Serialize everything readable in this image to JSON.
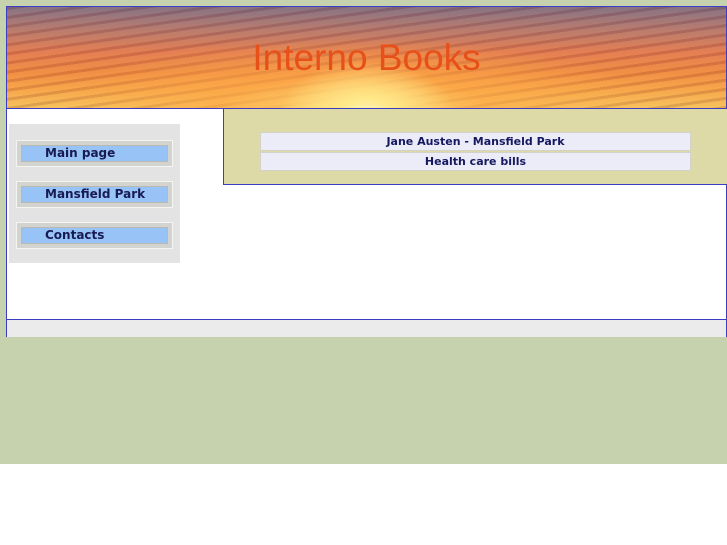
{
  "header": {
    "site_title": "Interno Books"
  },
  "sidebar": {
    "items": [
      {
        "label": "Main page"
      },
      {
        "label": "Mansfield Park"
      },
      {
        "label": "Contacts"
      }
    ]
  },
  "main": {
    "links": [
      {
        "label": "Jane Austen - Mansfield Park"
      },
      {
        "label": "Health care bills"
      }
    ]
  },
  "colors": {
    "page_background": "#c5d2ad",
    "frame_border": "#3b3ec4",
    "title_text": "#e8501a",
    "nav_button": "#98c3f7",
    "content_panel": "#dedaa8"
  }
}
